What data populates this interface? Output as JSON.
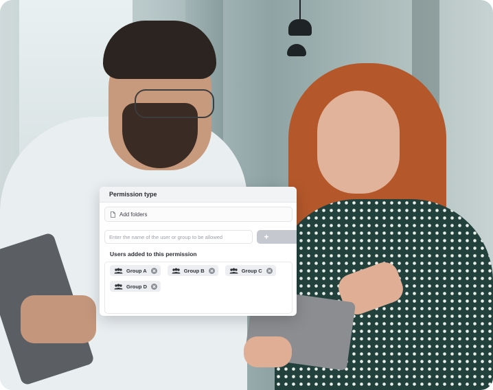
{
  "permission_panel": {
    "title": "Permission type",
    "permission_type": {
      "icon": "file-icon",
      "label": "Add folders"
    },
    "user_search": {
      "placeholder": "Enter the name of the user or group to be allowed",
      "value": ""
    },
    "add_button": {
      "label": "+"
    },
    "users_section_title": "Users added to this permission",
    "groups": [
      {
        "label": "Group A",
        "icon": "group-icon",
        "remove_icon": "close-icon"
      },
      {
        "label": "Group B",
        "icon": "group-icon",
        "remove_icon": "close-icon"
      },
      {
        "label": "Group C",
        "icon": "group-icon",
        "remove_icon": "close-icon"
      },
      {
        "label": "Group D",
        "icon": "group-icon",
        "remove_icon": "close-icon"
      }
    ]
  },
  "colors": {
    "card_header_bg": "#f2f3f5",
    "tag_bg": "#eceef1",
    "add_button_bg": "#c5c8ce"
  }
}
